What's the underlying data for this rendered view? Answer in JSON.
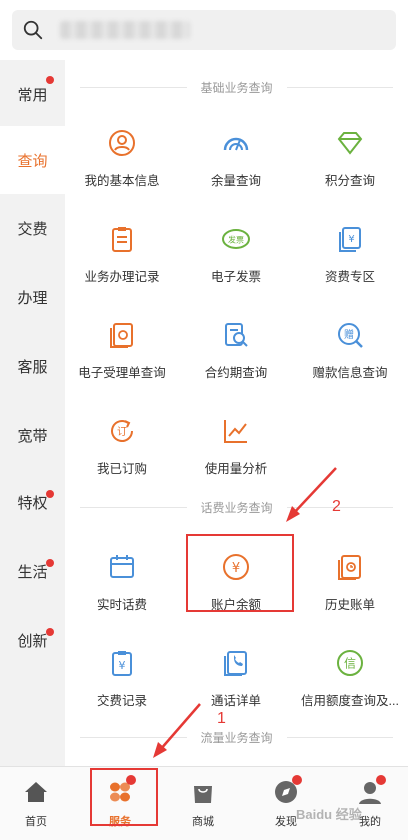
{
  "search": {
    "placeholder": ""
  },
  "sidebar": {
    "items": [
      {
        "label": "常用",
        "dot": true
      },
      {
        "label": "查询",
        "dot": false,
        "active": true
      },
      {
        "label": "交费",
        "dot": false
      },
      {
        "label": "办理",
        "dot": false
      },
      {
        "label": "客服",
        "dot": false
      },
      {
        "label": "宽带",
        "dot": false
      },
      {
        "label": "特权",
        "dot": true
      },
      {
        "label": "生活",
        "dot": true
      },
      {
        "label": "创新",
        "dot": true
      }
    ]
  },
  "sections": [
    {
      "title": "基础业务查询",
      "items": [
        {
          "label": "我的基本信息",
          "icon": "user-info-icon"
        },
        {
          "label": "余量查询",
          "icon": "gauge-icon"
        },
        {
          "label": "积分查询",
          "icon": "diamond-icon"
        },
        {
          "label": "业务办理记录",
          "icon": "clipboard-icon"
        },
        {
          "label": "电子发票",
          "icon": "invoice-icon"
        },
        {
          "label": "资费专区",
          "icon": "tariff-icon"
        },
        {
          "label": "电子受理单查询",
          "icon": "receipt-icon"
        },
        {
          "label": "合约期查询",
          "icon": "contract-search-icon"
        },
        {
          "label": "赠款信息查询",
          "icon": "gift-search-icon"
        },
        {
          "label": "我已订购",
          "icon": "subscribed-icon"
        },
        {
          "label": "使用量分析",
          "icon": "chart-icon"
        }
      ]
    },
    {
      "title": "话费业务查询",
      "items": [
        {
          "label": "实时话费",
          "icon": "calendar-icon"
        },
        {
          "label": "账户余额",
          "icon": "yen-coin-icon"
        },
        {
          "label": "历史账单",
          "icon": "history-bill-icon"
        },
        {
          "label": "交费记录",
          "icon": "payment-record-icon"
        },
        {
          "label": "通话详单",
          "icon": "call-detail-icon"
        },
        {
          "label": "信用额度查询及...",
          "icon": "credit-icon"
        }
      ]
    },
    {
      "title": "流量业务查询",
      "items": []
    }
  ],
  "annotations": {
    "label_1": "1",
    "label_2": "2"
  },
  "tabbar": {
    "items": [
      {
        "label": "首页",
        "icon": "home-icon"
      },
      {
        "label": "服务",
        "icon": "service-icon",
        "active": true,
        "dot": true
      },
      {
        "label": "商城",
        "icon": "shop-bag-icon"
      },
      {
        "label": "发现",
        "icon": "compass-icon",
        "dot": true
      },
      {
        "label": "我的",
        "icon": "profile-icon",
        "dot": true
      }
    ]
  },
  "watermark": "Baidu 经验",
  "colors": {
    "accent": "#e8712c",
    "icon_orange": "#e8712c",
    "icon_blue": "#4a90d9",
    "icon_green": "#6bb23f",
    "annotation_red": "#e53935"
  }
}
